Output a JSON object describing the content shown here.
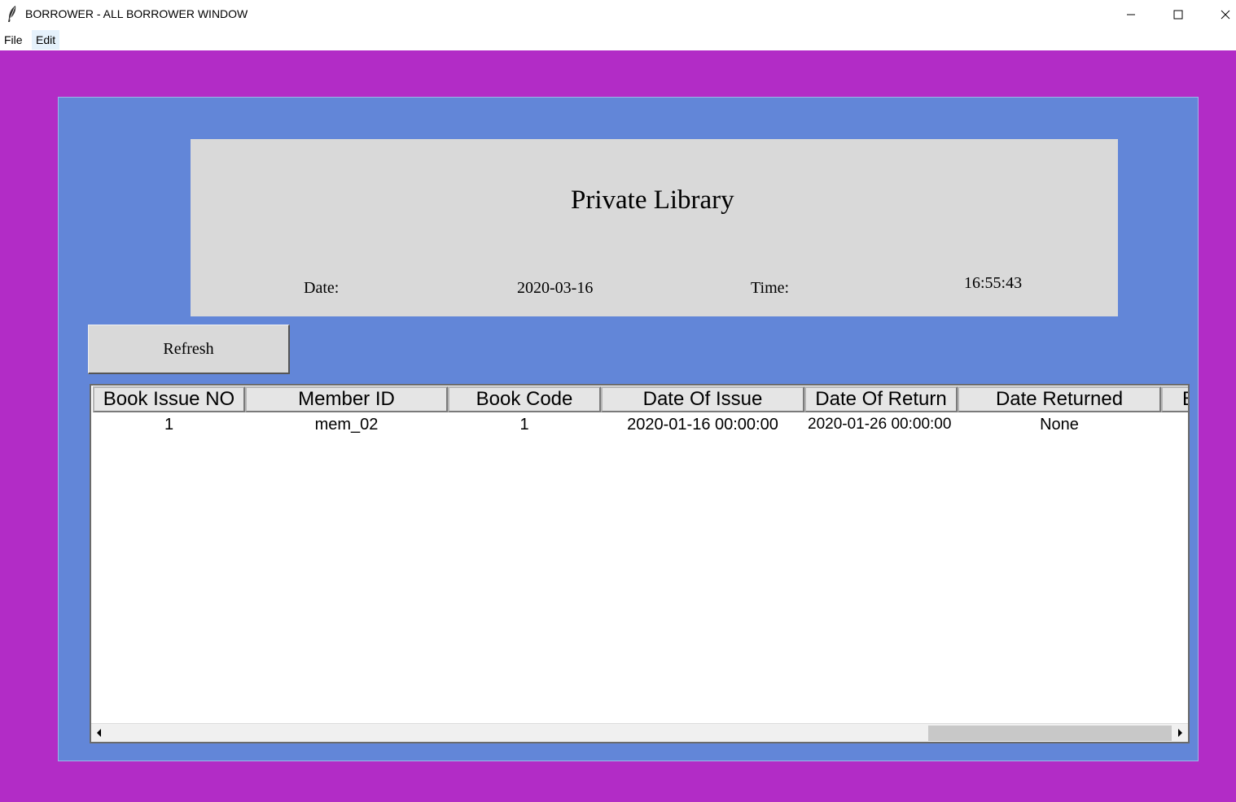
{
  "window": {
    "title": "BORROWER - ALL BORROWER WINDOW",
    "minimize_icon": "minimize-icon",
    "maximize_icon": "maximize-icon",
    "close_icon": "close-icon"
  },
  "menu": {
    "items": [
      "File",
      "Edit"
    ]
  },
  "header": {
    "title": "Private Library",
    "date_label": "Date:",
    "date_value": "2020-03-16",
    "time_label": "Time:",
    "time_value": "16:55:43"
  },
  "refresh_label": "Refresh",
  "table": {
    "columns": [
      "Book Issue NO",
      "Member ID",
      "Book Code",
      "Date Of Issue",
      "Date Of Return",
      "Date Returned",
      "B"
    ],
    "rows": [
      [
        "1",
        "mem_02",
        "1",
        "2020-01-16 00:00:00",
        "2020-01-26 00:00:00",
        "None"
      ]
    ]
  },
  "colors": {
    "outer_bg": "#b22cc6",
    "panel_bg": "#6286d8",
    "header_bg": "#d9d9d9"
  }
}
